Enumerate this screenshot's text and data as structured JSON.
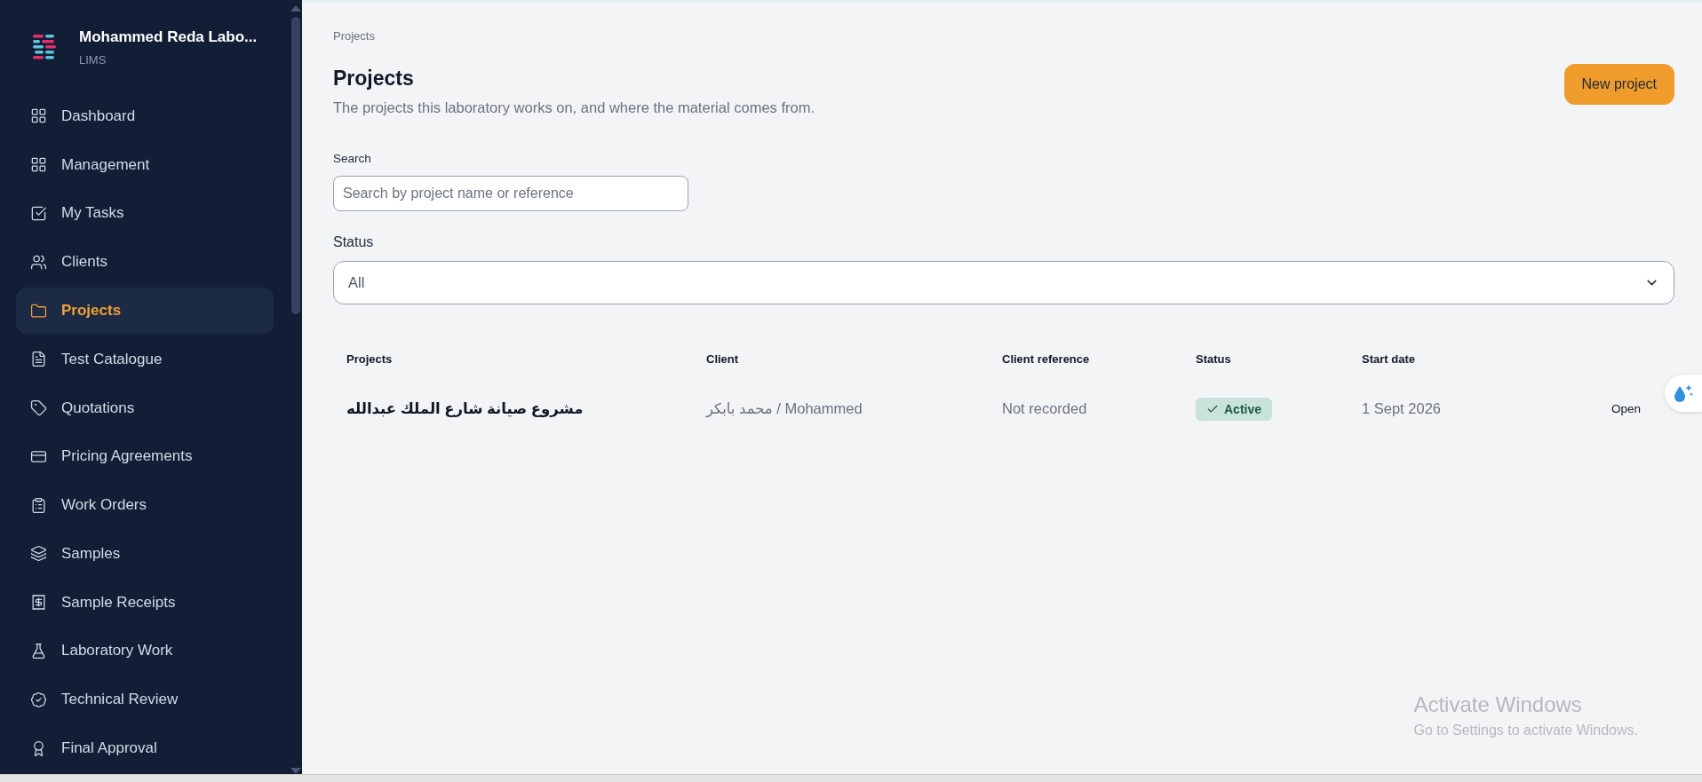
{
  "sidebar": {
    "org_name": "Mohammed Reda Labo...",
    "org_subtitle": "LIMS",
    "items": [
      {
        "label": "Dashboard",
        "selected": false
      },
      {
        "label": "Management",
        "selected": false
      },
      {
        "label": "My Tasks",
        "selected": false
      },
      {
        "label": "Clients",
        "selected": false
      },
      {
        "label": "Projects",
        "selected": true
      },
      {
        "label": "Test Catalogue",
        "selected": false
      },
      {
        "label": "Quotations",
        "selected": false
      },
      {
        "label": "Pricing Agreements",
        "selected": false
      },
      {
        "label": "Work Orders",
        "selected": false
      },
      {
        "label": "Samples",
        "selected": false
      },
      {
        "label": "Sample Receipts",
        "selected": false
      },
      {
        "label": "Laboratory Work",
        "selected": false
      },
      {
        "label": "Technical Review",
        "selected": false
      },
      {
        "label": "Final Approval",
        "selected": false
      }
    ]
  },
  "breadcrumb": "Projects",
  "page": {
    "title": "Projects",
    "description": "The projects this laboratory works on, and where the material comes from.",
    "new_button": "New project"
  },
  "filters": {
    "search": {
      "label": "Search",
      "placeholder": "Search by project name or reference"
    },
    "status": {
      "label": "Status",
      "value": "All"
    }
  },
  "table": {
    "columns": [
      "Projects",
      "Client",
      "Client reference",
      "Status",
      "Start date"
    ],
    "rows": [
      {
        "project": "مشروع صيانة شارع الملك عبدالله",
        "client": "محمد بابكر / Mohammed",
        "client_reference": "Not recorded",
        "status": "Active",
        "start_date": "1 Sept 2026",
        "action": "Open"
      }
    ]
  },
  "os_notice": {
    "title": "Activate Windows",
    "text": "Go to Settings to activate Windows."
  }
}
